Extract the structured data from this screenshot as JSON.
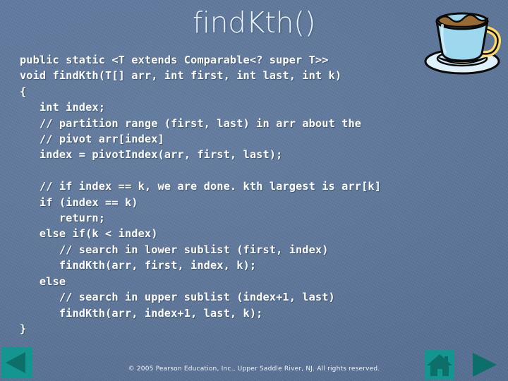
{
  "slide": {
    "title": "findKth()",
    "background_color": "#5b7599",
    "text_color": "#ffffff"
  },
  "code": {
    "language": "java",
    "lines": [
      "public static <T extends Comparable<? super T>>",
      "void findKth(T[] arr, int first, int last, int k)",
      "{",
      "   int index;",
      "   // partition range (first, last) in arr about the",
      "   // pivot arr[index]",
      "   index = pivotIndex(arr, first, last);",
      "",
      "   // if index == k, we are done. kth largest is arr[k]",
      "   if (index == k)",
      "      return;",
      "   else if(k < index)",
      "      // search in lower sublist (first, index)",
      "      findKth(arr, first, index, k);",
      "   else",
      "      // search in upper sublist (index+1, last)",
      "      findKth(arr, index+1, last, k);",
      "}"
    ]
  },
  "footer": {
    "copyright": "© 2005 Pearson Education, Inc., Upper Saddle River, NJ.  All rights reserved."
  },
  "navigation": {
    "previous_label": "Previous slide",
    "home_label": "Home",
    "next_label": "Next slide",
    "button_color": "#13968f",
    "glyph_color": "#0d6f69"
  },
  "decoration": {
    "cup_icon": "coffee-cup",
    "cup_body_color": "#9ed8ee",
    "cup_coffee_color": "#9a6a33",
    "cup_accent_color": "#ffd966",
    "saucer_color": "#dff1fb"
  }
}
